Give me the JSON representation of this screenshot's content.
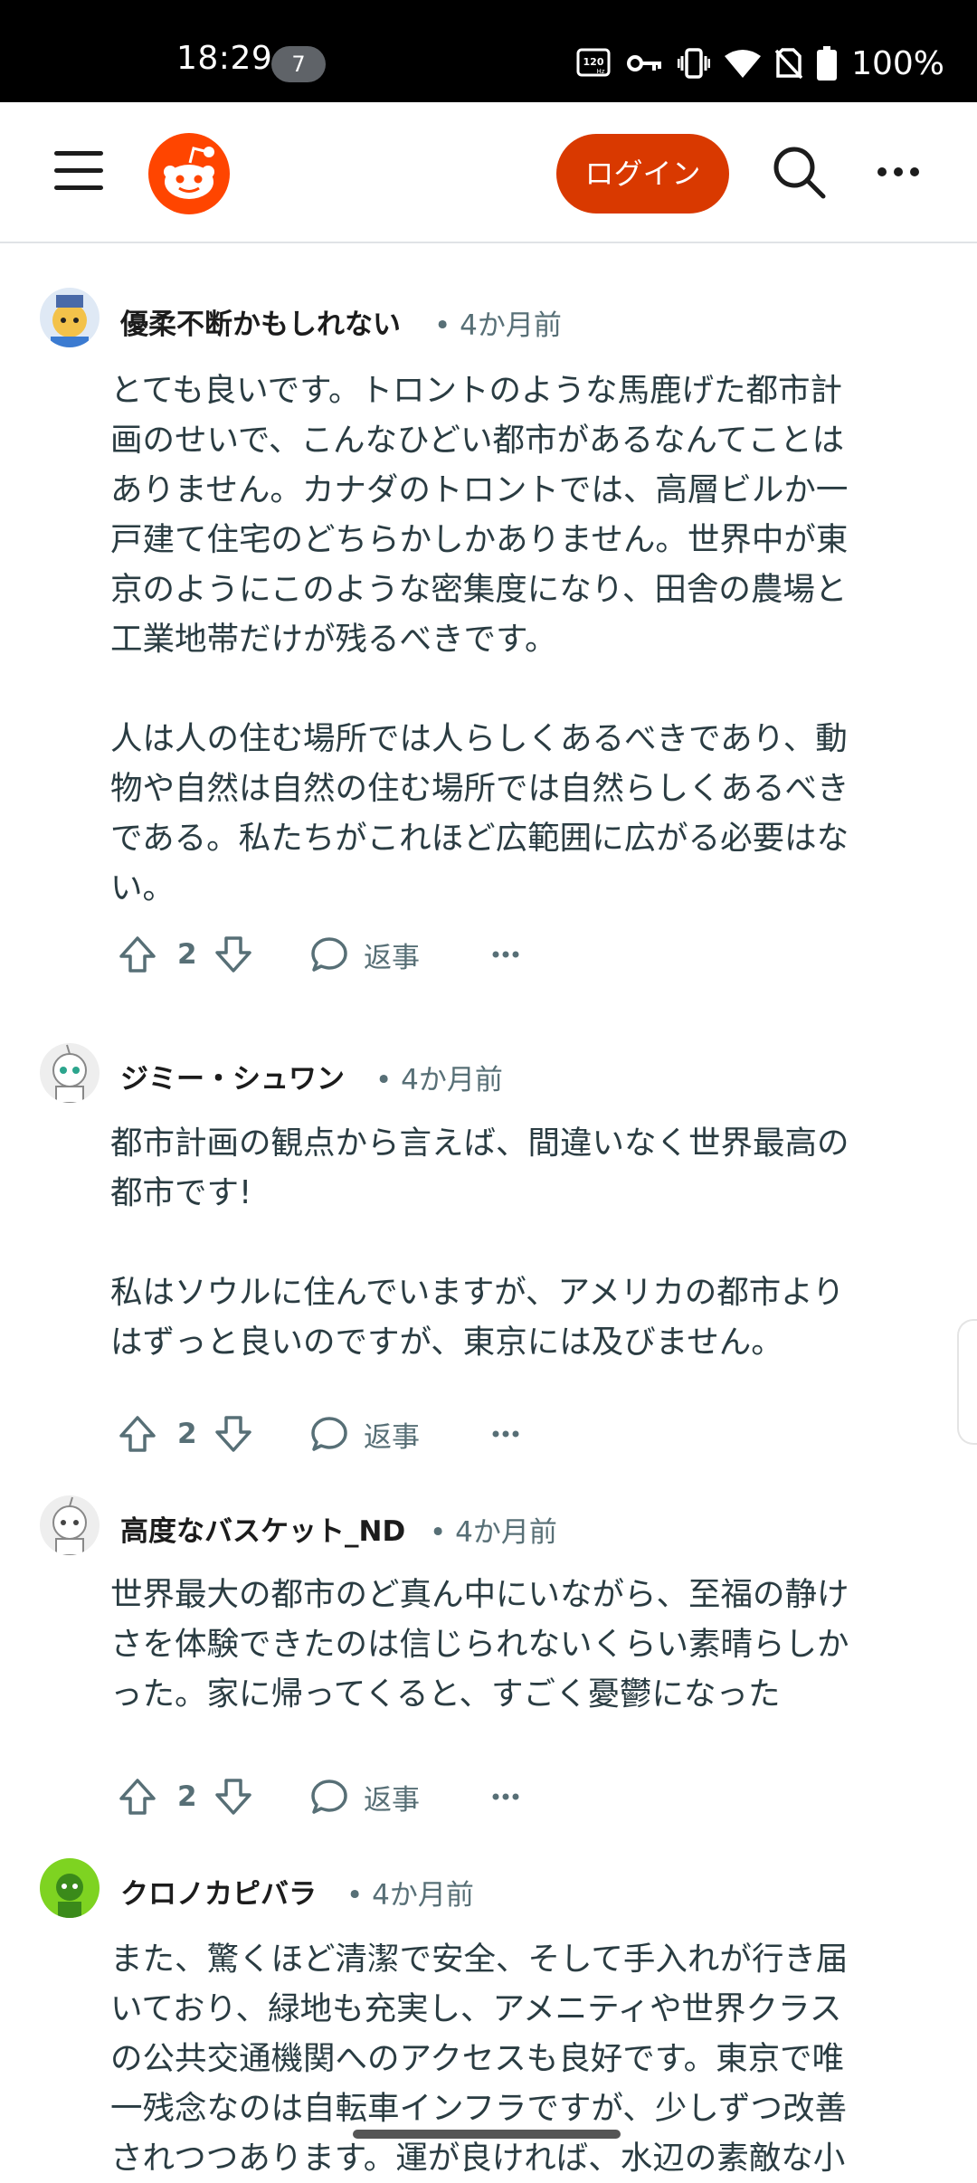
{
  "status_bar": {
    "time": "18:29",
    "notification_count": "7",
    "battery": "100%",
    "icons": [
      "120hz-icon",
      "vpn-key-icon",
      "vibrate-icon",
      "wifi-icon",
      "no-sim-icon",
      "battery-icon"
    ]
  },
  "header": {
    "login_label": "ログイン",
    "brand_color": "#d93900",
    "icons": [
      "menu-icon",
      "reddit-logo-icon",
      "search-icon",
      "more-icon"
    ]
  },
  "comments": [
    {
      "author": "優柔不断かもしれない",
      "time": "• 4か月前",
      "paragraphs": [
        [
          "とても良いです。トロントのような馬鹿げた都市計",
          "画のせいで、こんなひどい都市があるなんてことは",
          "ありません。カナダのトロントでは、高層ビルか一",
          "戸建て住宅のどちらかしかありません。世界中が東",
          "京のようにこのような密集度になり、田舎の農場と",
          "工業地帯だけが残るべきです。"
        ],
        [
          "人は人の住む場所では人らしくあるべきであり、動",
          "物や自然は自然の住む場所では自然らしくあるべき",
          "である。私たちがこれほど広範囲に広がる必要はな",
          "い。"
        ]
      ],
      "votes": "2",
      "reply_label": "返事"
    },
    {
      "author": "ジミー・シュワン",
      "time": "• 4か月前",
      "paragraphs": [
        [
          "都市計画の観点から言えば、間違いなく世界最高の",
          "都市です!"
        ],
        [
          "私はソウルに住んでいますが、アメリカの都市より",
          "はずっと良いのですが、東京には及びません。"
        ]
      ],
      "votes": "2",
      "reply_label": "返事"
    },
    {
      "author": "高度なバスケット_ND",
      "time": "• 4か月前",
      "paragraphs": [
        [
          "世界最大の都市のど真ん中にいながら、至福の静け",
          "さを体験できたのは信じられないくらい素晴らしか",
          "った。家に帰ってくると、すごく憂鬱になった"
        ]
      ],
      "votes": "2",
      "reply_label": "返事"
    },
    {
      "author": "クロノカピバラ",
      "time": "• 4か月前",
      "paragraphs": [
        [
          "また、驚くほど清潔で安全、そして手入れが行き届",
          "いており、緑地も充実し、アメニティや世界クラス",
          "の公共交通機関へのアクセスも良好です。東京で唯",
          "一残念なのは自転車インフラですが、少しずつ改善",
          "されつつあります。運が良ければ、水辺の素敵な小"
        ]
      ]
    }
  ]
}
